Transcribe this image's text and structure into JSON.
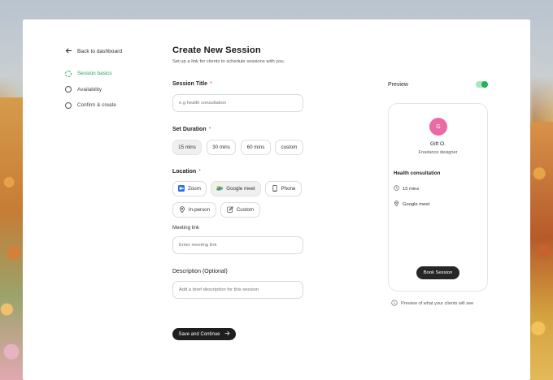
{
  "sidebar": {
    "back_label": "Back to dashboard",
    "steps": [
      {
        "label": "Session basics",
        "active": true
      },
      {
        "label": "Availability",
        "active": false
      },
      {
        "label": "Confirm & create",
        "active": false
      }
    ]
  },
  "form": {
    "title": "Create New Session",
    "subtitle": "Set up a link for clients to schedule sessions with you.",
    "session_title": {
      "label": "Session Title",
      "required": "*",
      "placeholder": "e.g health consultation"
    },
    "duration": {
      "label": "Set Duration",
      "required": "*",
      "options": [
        "15 mins",
        "30 mins",
        "60 mins",
        "custom"
      ],
      "selected": "15 mins"
    },
    "location": {
      "label": "Location",
      "required": "*",
      "options": [
        "Zoom",
        "Google meet",
        "Phone",
        "In-person",
        "Custom"
      ],
      "selected": "Google meet"
    },
    "meeting_link": {
      "label": "Meeting link",
      "placeholder": "Enter meeting link"
    },
    "description": {
      "label": "Description (Optional)",
      "placeholder": "Add a brief description for this session"
    },
    "save_label": "Save and Continue"
  },
  "preview": {
    "label": "Preview",
    "toggle_on": true,
    "avatar_initial": "G",
    "avatar_color": "#ea6aa7",
    "name": "Gift O.",
    "role": "Freelance designer",
    "topic": "Health consultation",
    "duration": "15 mins",
    "location": "Google meet",
    "book_label": "Book Session",
    "note": "Preview of what your clients will see"
  },
  "colors": {
    "accent_green": "#22a65a",
    "required_red": "#e0525a",
    "button_dark": "#1e1e1e"
  }
}
